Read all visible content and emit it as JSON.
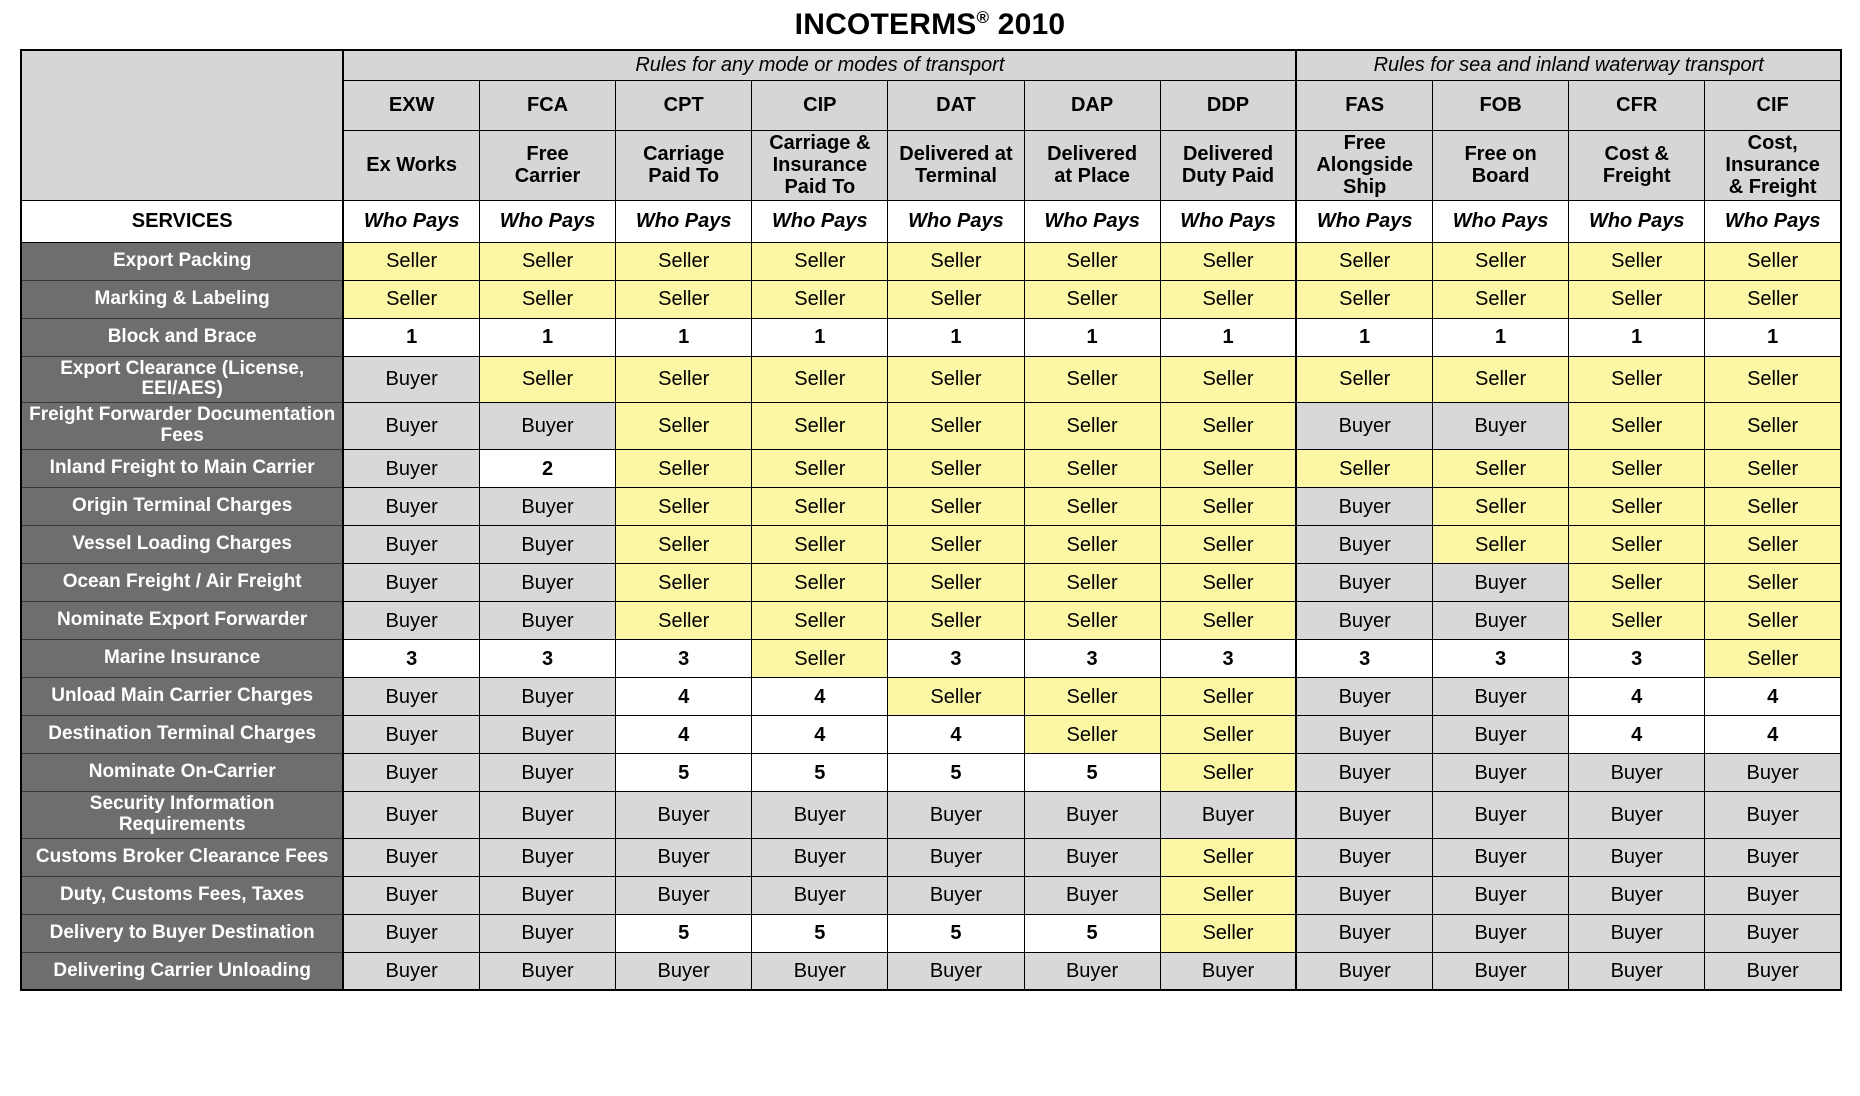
{
  "title": {
    "main": "INCOTERMS",
    "trademark": "®",
    "year": "2010"
  },
  "header": {
    "group_any": "Rules for any mode or modes of transport",
    "group_sea": "Rules for sea and inland waterway transport",
    "services_label": "SERVICES",
    "who_pays": "Who Pays",
    "accent_any_color": "#ff0000",
    "accent_sea_color": "#0000ff",
    "terms": [
      {
        "code": "EXW",
        "name": "Ex Works",
        "group": "any"
      },
      {
        "code": "FCA",
        "name": "Free\nCarrier",
        "group": "any"
      },
      {
        "code": "CPT",
        "name": "Carriage\nPaid To",
        "group": "any"
      },
      {
        "code": "CIP",
        "name": "Carriage &\nInsurance\nPaid To",
        "group": "any"
      },
      {
        "code": "DAT",
        "name": "Delivered at\nTerminal",
        "group": "any"
      },
      {
        "code": "DAP",
        "name": "Delivered\nat Place",
        "group": "any"
      },
      {
        "code": "DDP",
        "name": "Delivered\nDuty Paid",
        "group": "any"
      },
      {
        "code": "FAS",
        "name": "Free\nAlongside\nShip",
        "group": "sea"
      },
      {
        "code": "FOB",
        "name": "Free on\nBoard",
        "group": "sea"
      },
      {
        "code": "CFR",
        "name": "Cost &\nFreight",
        "group": "sea"
      },
      {
        "code": "CIF",
        "name": "Cost,\nInsurance\n& Freight",
        "group": "sea"
      }
    ]
  },
  "legend_colors": {
    "seller_bg": "#fbf7a5",
    "buyer_bg": "#d8d8d8",
    "number_bg": "#ffffff",
    "rowlabel_bg": "#6e6e6e",
    "header_bg": "#d6d6d6"
  },
  "rows": [
    {
      "label": "Export Packing",
      "values": [
        "Seller",
        "Seller",
        "Seller",
        "Seller",
        "Seller",
        "Seller",
        "Seller",
        "Seller",
        "Seller",
        "Seller",
        "Seller"
      ]
    },
    {
      "label": "Marking & Labeling",
      "values": [
        "Seller",
        "Seller",
        "Seller",
        "Seller",
        "Seller",
        "Seller",
        "Seller",
        "Seller",
        "Seller",
        "Seller",
        "Seller"
      ]
    },
    {
      "label": "Block and Brace",
      "values": [
        "1",
        "1",
        "1",
        "1",
        "1",
        "1",
        "1",
        "1",
        "1",
        "1",
        "1"
      ]
    },
    {
      "label": "Export Clearance (License, EEI/AES)",
      "values": [
        "Buyer",
        "Seller",
        "Seller",
        "Seller",
        "Seller",
        "Seller",
        "Seller",
        "Seller",
        "Seller",
        "Seller",
        "Seller"
      ]
    },
    {
      "label": "Freight Forwarder Documentation Fees",
      "values": [
        "Buyer",
        "Buyer",
        "Seller",
        "Seller",
        "Seller",
        "Seller",
        "Seller",
        "Buyer",
        "Buyer",
        "Seller",
        "Seller"
      ]
    },
    {
      "label": "Inland Freight to Main Carrier",
      "values": [
        "Buyer",
        "2",
        "Seller",
        "Seller",
        "Seller",
        "Seller",
        "Seller",
        "Seller",
        "Seller",
        "Seller",
        "Seller"
      ]
    },
    {
      "label": "Origin Terminal Charges",
      "values": [
        "Buyer",
        "Buyer",
        "Seller",
        "Seller",
        "Seller",
        "Seller",
        "Seller",
        "Buyer",
        "Seller",
        "Seller",
        "Seller"
      ]
    },
    {
      "label": "Vessel Loading Charges",
      "values": [
        "Buyer",
        "Buyer",
        "Seller",
        "Seller",
        "Seller",
        "Seller",
        "Seller",
        "Buyer",
        "Seller",
        "Seller",
        "Seller"
      ]
    },
    {
      "label": "Ocean Freight / Air Freight",
      "values": [
        "Buyer",
        "Buyer",
        "Seller",
        "Seller",
        "Seller",
        "Seller",
        "Seller",
        "Buyer",
        "Buyer",
        "Seller",
        "Seller"
      ]
    },
    {
      "label": "Nominate Export Forwarder",
      "values": [
        "Buyer",
        "Buyer",
        "Seller",
        "Seller",
        "Seller",
        "Seller",
        "Seller",
        "Buyer",
        "Buyer",
        "Seller",
        "Seller"
      ]
    },
    {
      "label": "Marine Insurance",
      "values": [
        "3",
        "3",
        "3",
        "Seller",
        "3",
        "3",
        "3",
        "3",
        "3",
        "3",
        "Seller"
      ]
    },
    {
      "label": "Unload Main Carrier Charges",
      "values": [
        "Buyer",
        "Buyer",
        "4",
        "4",
        "Seller",
        "Seller",
        "Seller",
        "Buyer",
        "Buyer",
        "4",
        "4"
      ]
    },
    {
      "label": "Destination Terminal Charges",
      "values": [
        "Buyer",
        "Buyer",
        "4",
        "4",
        "4",
        "Seller",
        "Seller",
        "Buyer",
        "Buyer",
        "4",
        "4"
      ]
    },
    {
      "label": "Nominate On-Carrier",
      "values": [
        "Buyer",
        "Buyer",
        "5",
        "5",
        "5",
        "5",
        "Seller",
        "Buyer",
        "Buyer",
        "Buyer",
        "Buyer"
      ]
    },
    {
      "label": "Security Information Requirements",
      "values": [
        "Buyer",
        "Buyer",
        "Buyer",
        "Buyer",
        "Buyer",
        "Buyer",
        "Buyer",
        "Buyer",
        "Buyer",
        "Buyer",
        "Buyer"
      ]
    },
    {
      "label": "Customs Broker Clearance Fees",
      "values": [
        "Buyer",
        "Buyer",
        "Buyer",
        "Buyer",
        "Buyer",
        "Buyer",
        "Seller",
        "Buyer",
        "Buyer",
        "Buyer",
        "Buyer"
      ]
    },
    {
      "label": "Duty, Customs Fees, Taxes",
      "values": [
        "Buyer",
        "Buyer",
        "Buyer",
        "Buyer",
        "Buyer",
        "Buyer",
        "Seller",
        "Buyer",
        "Buyer",
        "Buyer",
        "Buyer"
      ]
    },
    {
      "label": "Delivery to Buyer Destination",
      "values": [
        "Buyer",
        "Buyer",
        "5",
        "5",
        "5",
        "5",
        "Seller",
        "Buyer",
        "Buyer",
        "Buyer",
        "Buyer"
      ]
    },
    {
      "label": "Delivering Carrier Unloading",
      "values": [
        "Buyer",
        "Buyer",
        "Buyer",
        "Buyer",
        "Buyer",
        "Buyer",
        "Buyer",
        "Buyer",
        "Buyer",
        "Buyer",
        "Buyer"
      ]
    }
  ]
}
